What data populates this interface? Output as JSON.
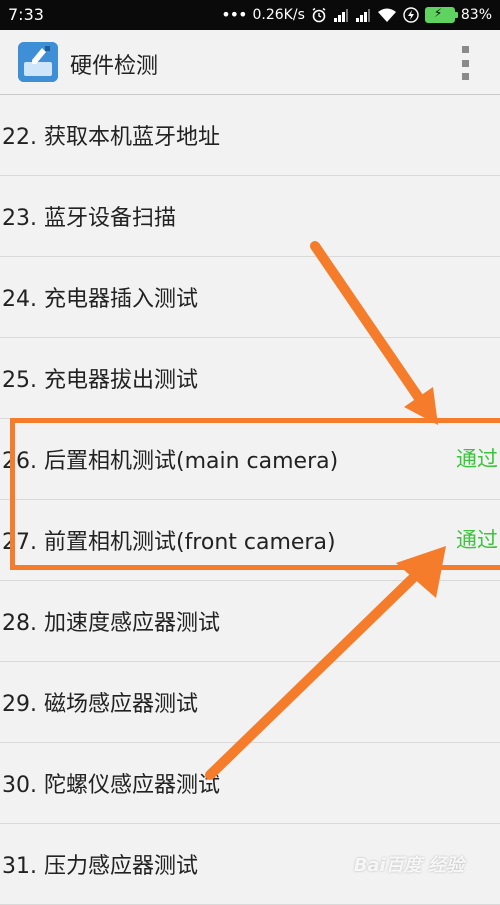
{
  "status_bar": {
    "time": "7:33",
    "network_speed": "0.26K/s",
    "battery_percent": "83%",
    "icons": [
      "dots-icon",
      "alarm-icon",
      "signal-icon",
      "signal-icon",
      "wifi-icon",
      "charging-icon",
      "battery-icon"
    ]
  },
  "app_bar": {
    "title": "硬件检测",
    "icon": "app-logo-icon",
    "menu_icon": "overflow-menu-icon"
  },
  "list": {
    "items": [
      {
        "label": "22. 获取本机蓝牙地址",
        "status": ""
      },
      {
        "label": "23. 蓝牙设备扫描",
        "status": ""
      },
      {
        "label": "24. 充电器插入测试",
        "status": ""
      },
      {
        "label": "25. 充电器拔出测试",
        "status": ""
      },
      {
        "label": "26. 后置相机测试(main camera)",
        "status": "通过"
      },
      {
        "label": "27. 前置相机测试(front camera)",
        "status": "通过"
      },
      {
        "label": "28. 加速度感应器测试",
        "status": ""
      },
      {
        "label": "29. 磁场感应器测试",
        "status": ""
      },
      {
        "label": "30. 陀螺仪感应器测试",
        "status": ""
      },
      {
        "label": "31. 压力感应器测试",
        "status": ""
      }
    ]
  },
  "annotation": {
    "highlight_color": "#f47c2a",
    "pass_color": "#3cc43c"
  },
  "watermark": {
    "text": "Bai百度 经验"
  }
}
